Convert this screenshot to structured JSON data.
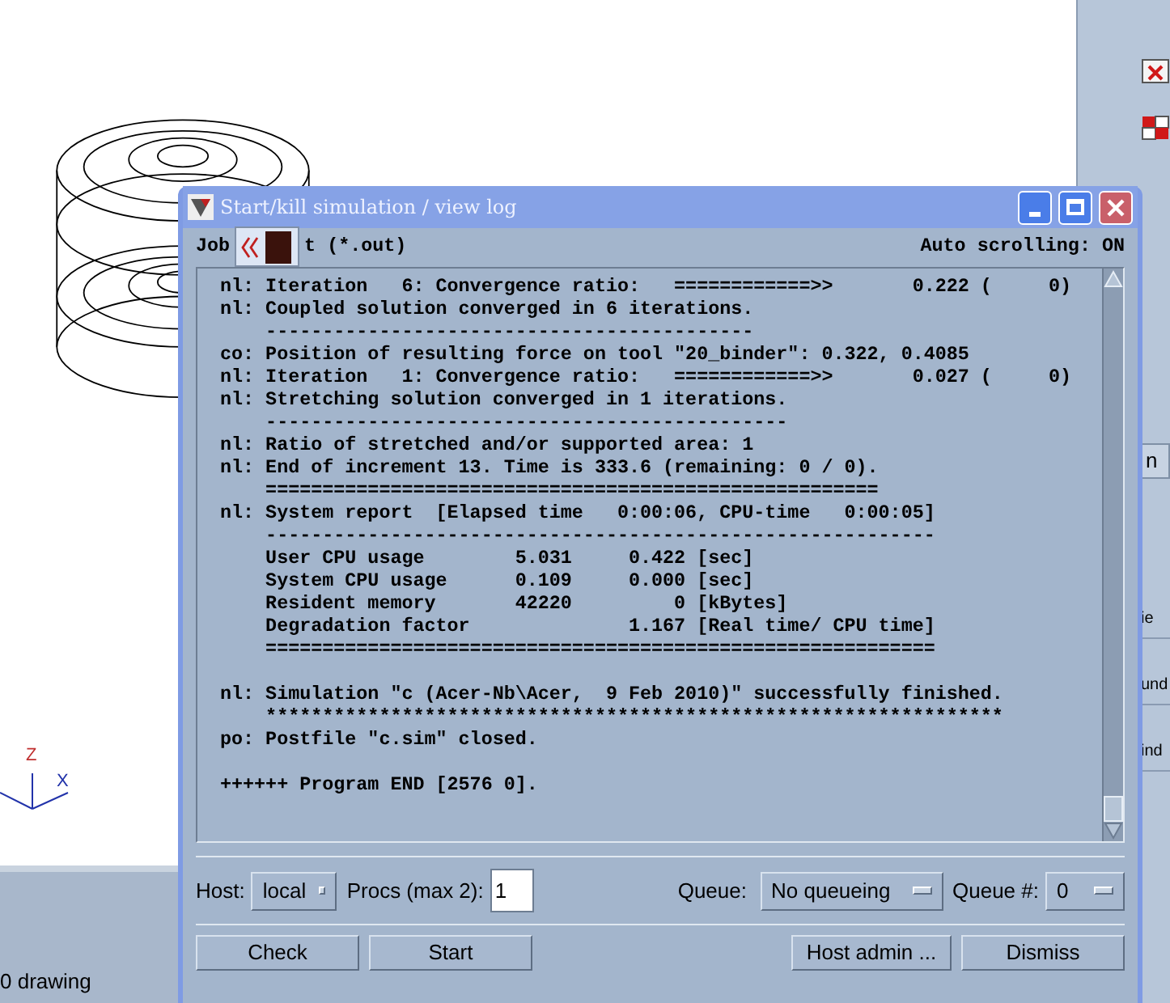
{
  "background": {
    "axis_labels": [
      "Z",
      "X"
    ],
    "status_text": "0 drawing",
    "toolbar_labels": [
      "n",
      "ie",
      "und",
      "ind"
    ]
  },
  "dialog": {
    "title": "Start/kill simulation / view log",
    "job_label_parts": [
      "Job",
      "t (*.out)"
    ],
    "auto_scrolling": "Auto scrolling: ON",
    "log": [
      [
        "nl: Iteration   6: Convergence ratio:   ============>>       0.222 (     0)",
        "nl: Coupled solution converged in 6 iterations.",
        "    -------------------------------------------",
        "co: Position of resulting force on tool \"20_binder\": 0.322, 0.4085",
        "nl: Iteration   1: Convergence ratio:   ============>>       0.027 (     0)",
        "nl: Stretching solution converged in 1 iterations.",
        "    ----------------------------------------------",
        "nl: Ratio of stretched and/or supported area: 1",
        "nl: End of increment 13. Time is 333.6 (remaining: 0 / 0).",
        "    ======================================================",
        "nl: System report  [Elapsed time   0:00:06, CPU-time   0:00:05]",
        "    -----------------------------------------------------------",
        "    User CPU usage        5.031     0.422 [sec]",
        "    System CPU usage      0.109     0.000 [sec]",
        "    Resident memory       42220         0 [kBytes]",
        "    Degradation factor              1.167 [Real time/ CPU time]",
        "    ==========================================================="
      ],
      [
        "nl: Simulation \"c (Acer-Nb\\Acer,  9 Feb 2010)\" successfully finished.",
        "    *****************************************************************",
        "po: Postfile \"c.sim\" closed."
      ],
      [
        "++++++ Program END [2576 0]."
      ]
    ],
    "host_label": "Host:",
    "host_value": "local",
    "procs_label": "Procs (max 2):",
    "procs_value": "1",
    "queue_label": "Queue:",
    "queue_value": "No queueing",
    "queue_num_label": "Queue #:",
    "queue_num_value": "0",
    "buttons": [
      "Check",
      "Start",
      "Host admin ...",
      "Dismiss"
    ]
  }
}
